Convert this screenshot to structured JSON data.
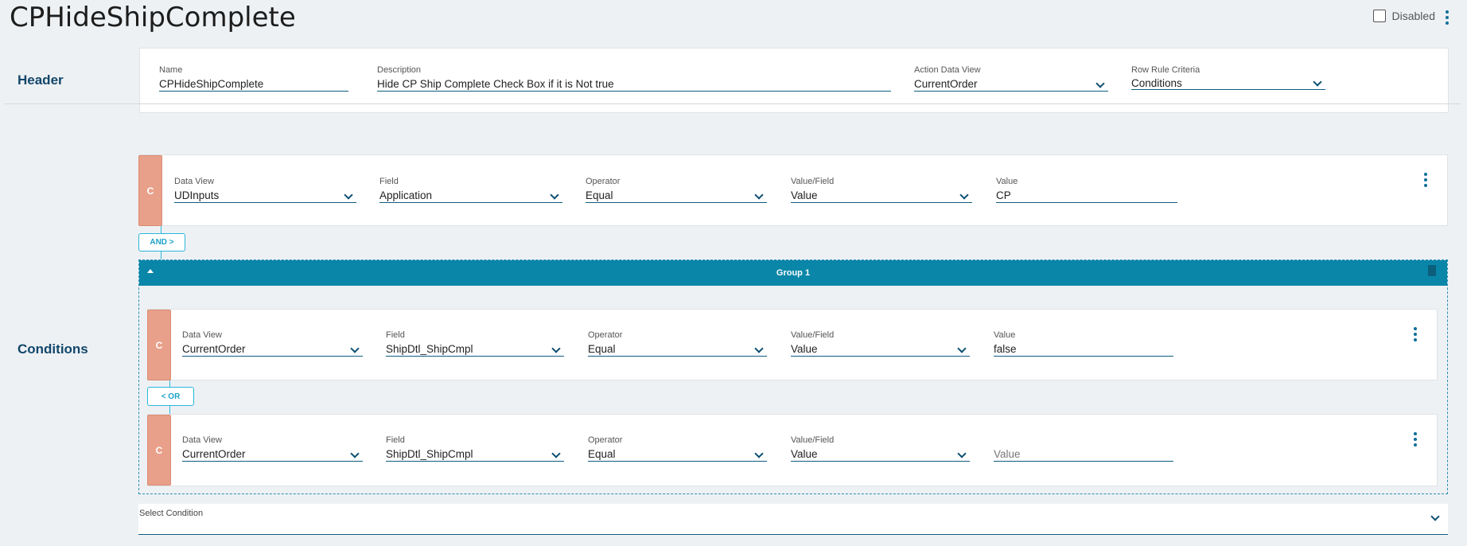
{
  "page": {
    "title": "CPHideShipComplete",
    "disabled_label": "Disabled"
  },
  "header": {
    "section_label": "Header",
    "name": {
      "label": "Name",
      "value": "CPHideShipComplete"
    },
    "description": {
      "label": "Description",
      "value": "Hide CP Ship Complete Check Box if it is Not true"
    },
    "action_data_view": {
      "label": "Action Data View",
      "value": "CurrentOrder"
    },
    "row_rule_criteria": {
      "label": "Row Rule Criteria",
      "value": "Conditions"
    }
  },
  "conditions": {
    "section_label": "Conditions",
    "condition_badge": "C",
    "row1": {
      "data_view": {
        "label": "Data View",
        "value": "UDInputs"
      },
      "field": {
        "label": "Field",
        "value": "Application"
      },
      "operator": {
        "label": "Operator",
        "value": "Equal"
      },
      "value_field": {
        "label": "Value/Field",
        "value": "Value"
      },
      "value": {
        "label": "Value",
        "value": "CP"
      }
    },
    "and_button": "AND >",
    "group": {
      "title": "Group 1",
      "row1": {
        "data_view": {
          "label": "Data View",
          "value": "CurrentOrder"
        },
        "field": {
          "label": "Field",
          "value": "ShipDtl_ShipCmpl"
        },
        "operator": {
          "label": "Operator",
          "value": "Equal"
        },
        "value_field": {
          "label": "Value/Field",
          "value": "Value"
        },
        "value": {
          "label": "Value",
          "value": "false"
        }
      },
      "or_button": "< OR",
      "row2": {
        "data_view": {
          "label": "Data View",
          "value": "CurrentOrder"
        },
        "field": {
          "label": "Field",
          "value": "ShipDtl_ShipCmpl"
        },
        "operator": {
          "label": "Operator",
          "value": "Equal"
        },
        "value_field": {
          "label": "Value/Field",
          "value": "Value"
        },
        "value": {
          "placeholder": "Value"
        }
      }
    },
    "select_condition": {
      "label": "Select Condition"
    }
  },
  "colors": {
    "accent": "#0a86a8",
    "condition_badge": "#e9a08a",
    "section_label": "#12476a",
    "logic_button": "#2ab6dc"
  },
  "icons": [
    "checkbox-icon",
    "more-vert-icon",
    "chevron-down-icon",
    "chevron-up-icon",
    "trash-icon"
  ]
}
